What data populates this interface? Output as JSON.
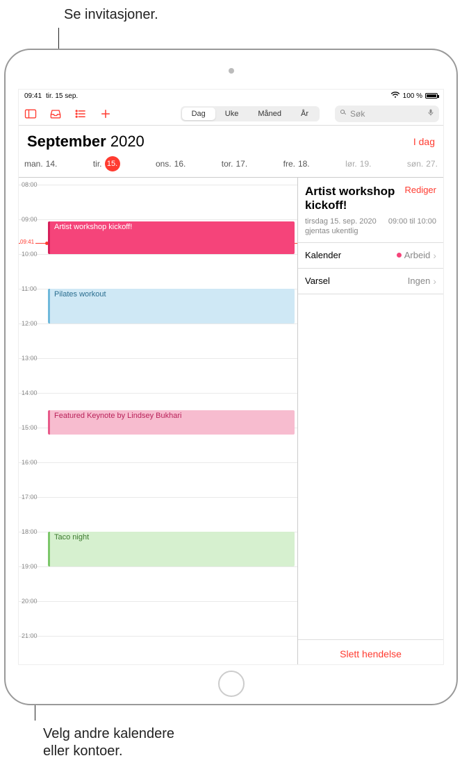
{
  "callouts": {
    "top": "Se invitasjoner.",
    "bottom": "Velg andre kalendere\neller kontoer."
  },
  "status": {
    "time": "09:41",
    "date": "tir. 15 sep.",
    "battery_pct": "100 %"
  },
  "toolbar": {
    "segments": {
      "day": "Dag",
      "week": "Uke",
      "month": "Måned",
      "year": "År"
    },
    "search_placeholder": "Søk"
  },
  "header": {
    "month": "September",
    "year": "2020",
    "today_link": "I dag"
  },
  "day_strip": [
    {
      "wd": "man.",
      "num": "14."
    },
    {
      "wd": "tir.",
      "num": "15."
    },
    {
      "wd": "ons.",
      "num": "16."
    },
    {
      "wd": "tor.",
      "num": "17."
    },
    {
      "wd": "fre.",
      "num": "18."
    },
    {
      "wd": "lør.",
      "num": "19."
    },
    {
      "wd": "søn.",
      "num": "27."
    }
  ],
  "timeline": {
    "now_label": "09:41",
    "hours": [
      "08:00",
      "09:00",
      "10:00",
      "11:00",
      "12:00",
      "13:00",
      "14:00",
      "15:00",
      "16:00",
      "17:00",
      "18:00",
      "19:00",
      "20:00",
      "21:00"
    ]
  },
  "events": [
    {
      "title": "Artist workshop kickoff!",
      "cls": "ev-pink",
      "top_hr": 9.05,
      "end_hr": 10.0
    },
    {
      "title": "Pilates workout",
      "cls": "ev-blue",
      "top_hr": 11.0,
      "end_hr": 12.0
    },
    {
      "title": "Featured Keynote by Lindsey Bukhari",
      "cls": "ev-pink-light",
      "top_hr": 14.5,
      "end_hr": 15.2
    },
    {
      "title": "Taco night",
      "cls": "ev-green",
      "top_hr": 18.0,
      "end_hr": 19.0
    }
  ],
  "detail": {
    "title": "Artist workshop kickoff!",
    "edit": "Rediger",
    "date_line": "tirsdag 15. sep. 2020",
    "repeat_line": "gjentas ukentlig",
    "time_line": "09:00 til 10:00",
    "rows": {
      "cal_label": "Kalender",
      "cal_value": "Arbeid",
      "alert_label": "Varsel",
      "alert_value": "Ingen"
    },
    "delete": "Slett hendelse"
  }
}
